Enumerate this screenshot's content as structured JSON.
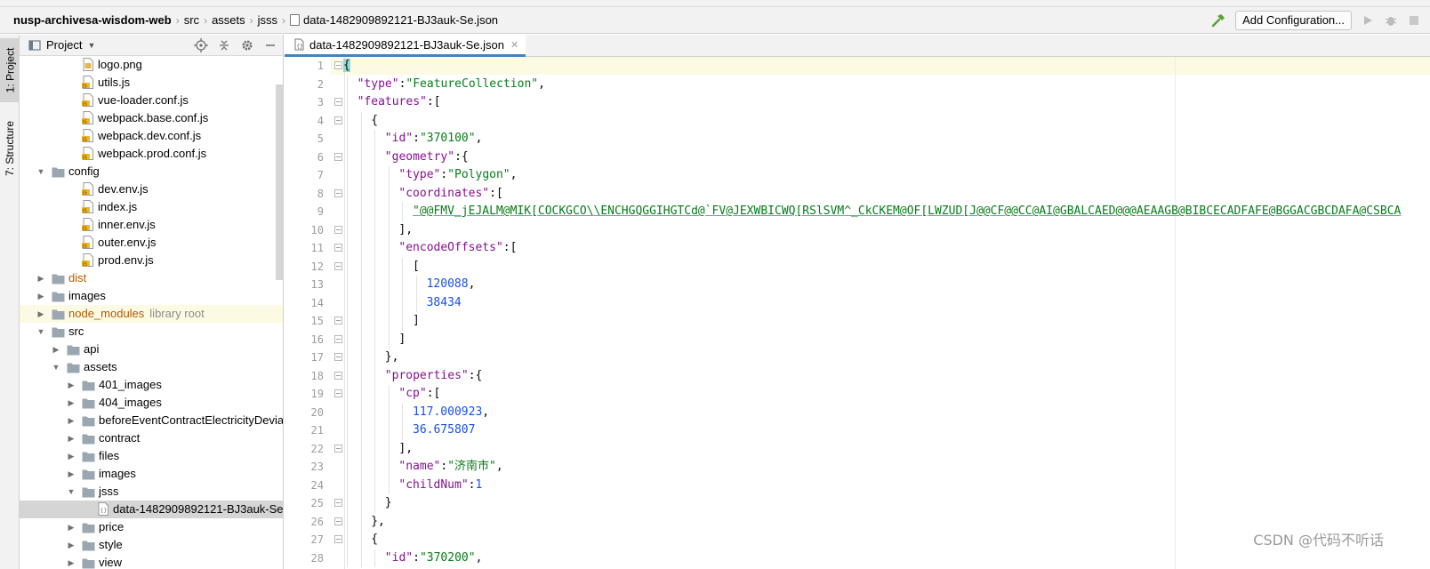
{
  "navbar": {
    "breadcrumbs": [
      "nusp-archivesa-wisdom-web",
      "src",
      "assets",
      "jsss",
      "data-1482909892121-BJ3auk-Se.json"
    ],
    "add_config_label": "Add Configuration..."
  },
  "toolstrip": {
    "project_tab": "1: Project",
    "structure_tab": "7: Structure"
  },
  "project_panel": {
    "title": "Project",
    "library_root_label": "library root",
    "tree": [
      {
        "label": "logo.png",
        "kind": "png",
        "depth": 3
      },
      {
        "label": "utils.js",
        "kind": "js",
        "depth": 3
      },
      {
        "label": "vue-loader.conf.js",
        "kind": "js",
        "depth": 3
      },
      {
        "label": "webpack.base.conf.js",
        "kind": "js",
        "depth": 3
      },
      {
        "label": "webpack.dev.conf.js",
        "kind": "js",
        "depth": 3
      },
      {
        "label": "webpack.prod.conf.js",
        "kind": "js",
        "depth": 3
      },
      {
        "label": "config",
        "kind": "folder",
        "depth": 1,
        "expanded": true
      },
      {
        "label": "dev.env.js",
        "kind": "js",
        "depth": 3
      },
      {
        "label": "index.js",
        "kind": "js",
        "depth": 3
      },
      {
        "label": "inner.env.js",
        "kind": "js",
        "depth": 3
      },
      {
        "label": "outer.env.js",
        "kind": "js",
        "depth": 3
      },
      {
        "label": "prod.env.js",
        "kind": "js",
        "depth": 3
      },
      {
        "label": "dist",
        "kind": "folder",
        "depth": 1,
        "expanded": false,
        "style": "excluded"
      },
      {
        "label": "images",
        "kind": "folder",
        "depth": 1,
        "expanded": false
      },
      {
        "label": "node_modules",
        "kind": "folder",
        "depth": 1,
        "expanded": false,
        "style": "library"
      },
      {
        "label": "src",
        "kind": "folder",
        "depth": 1,
        "expanded": true
      },
      {
        "label": "api",
        "kind": "folder",
        "depth": 2,
        "expanded": false
      },
      {
        "label": "assets",
        "kind": "folder",
        "depth": 2,
        "expanded": true
      },
      {
        "label": "401_images",
        "kind": "folder",
        "depth": 3,
        "expanded": false
      },
      {
        "label": "404_images",
        "kind": "folder",
        "depth": 3,
        "expanded": false
      },
      {
        "label": "beforeEventContractElectricityDevia",
        "kind": "folder",
        "depth": 3,
        "expanded": false
      },
      {
        "label": "contract",
        "kind": "folder",
        "depth": 3,
        "expanded": false
      },
      {
        "label": "files",
        "kind": "folder",
        "depth": 3,
        "expanded": false
      },
      {
        "label": "images",
        "kind": "folder",
        "depth": 3,
        "expanded": false
      },
      {
        "label": "jsss",
        "kind": "folder",
        "depth": 3,
        "expanded": true
      },
      {
        "label": "data-1482909892121-BJ3auk-Se",
        "kind": "json",
        "depth": 4,
        "selected": true
      },
      {
        "label": "price",
        "kind": "folder",
        "depth": 3,
        "expanded": false
      },
      {
        "label": "style",
        "kind": "folder",
        "depth": 3,
        "expanded": false
      },
      {
        "label": "view",
        "kind": "folder",
        "depth": 3,
        "expanded": false
      }
    ]
  },
  "editor": {
    "tab_label": "data-1482909892121-BJ3auk-Se.json",
    "lines": [
      {
        "n": "1",
        "indent": 0,
        "fold": true,
        "tokens": [
          {
            "t": "p",
            "v": "{"
          }
        ]
      },
      {
        "n": "2",
        "indent": 1,
        "fold": false,
        "tokens": [
          {
            "t": "k",
            "v": "\"type\""
          },
          {
            "t": "p",
            "v": ":"
          },
          {
            "t": "s",
            "v": "\"FeatureCollection\""
          },
          {
            "t": "p",
            "v": ","
          }
        ]
      },
      {
        "n": "3",
        "indent": 1,
        "fold": true,
        "tokens": [
          {
            "t": "k",
            "v": "\"features\""
          },
          {
            "t": "p",
            "v": ":["
          }
        ]
      },
      {
        "n": "4",
        "indent": 2,
        "fold": true,
        "tokens": [
          {
            "t": "p",
            "v": "{"
          }
        ]
      },
      {
        "n": "5",
        "indent": 3,
        "fold": false,
        "tokens": [
          {
            "t": "k",
            "v": "\"id\""
          },
          {
            "t": "p",
            "v": ":"
          },
          {
            "t": "s",
            "v": "\"370100\""
          },
          {
            "t": "p",
            "v": ","
          }
        ]
      },
      {
        "n": "6",
        "indent": 3,
        "fold": true,
        "tokens": [
          {
            "t": "k",
            "v": "\"geometry\""
          },
          {
            "t": "p",
            "v": ":{"
          }
        ]
      },
      {
        "n": "7",
        "indent": 4,
        "fold": false,
        "tokens": [
          {
            "t": "k",
            "v": "\"type\""
          },
          {
            "t": "p",
            "v": ":"
          },
          {
            "t": "s",
            "v": "\"Polygon\""
          },
          {
            "t": "p",
            "v": ","
          }
        ]
      },
      {
        "n": "8",
        "indent": 4,
        "fold": true,
        "tokens": [
          {
            "t": "k",
            "v": "\"coordinates\""
          },
          {
            "t": "p",
            "v": ":["
          }
        ]
      },
      {
        "n": "9",
        "indent": 5,
        "fold": false,
        "tokens": [
          {
            "t": "s",
            "v": "\"@@FMV_jEJALM@MIK[COCKGCO\\\\ENCHGQGGIHGTCd@`FV@JEXWBICWQ[RSlSVM^_CkCKEM@OF[LWZUD[J@@CF@@CC@AI@GBALCAED@@@AEAAGB@BIBCECADFAFE@BGGACGBCDAFA@CSBCA"
          }
        ]
      },
      {
        "n": "10",
        "indent": 4,
        "fold": true,
        "tokens": [
          {
            "t": "p",
            "v": "],"
          }
        ]
      },
      {
        "n": "11",
        "indent": 4,
        "fold": true,
        "tokens": [
          {
            "t": "k",
            "v": "\"encodeOffsets\""
          },
          {
            "t": "p",
            "v": ":["
          }
        ]
      },
      {
        "n": "12",
        "indent": 5,
        "fold": true,
        "tokens": [
          {
            "t": "p",
            "v": "["
          }
        ]
      },
      {
        "n": "13",
        "indent": 6,
        "fold": false,
        "tokens": [
          {
            "t": "n",
            "v": "120088"
          },
          {
            "t": "p",
            "v": ","
          }
        ]
      },
      {
        "n": "14",
        "indent": 6,
        "fold": false,
        "tokens": [
          {
            "t": "n",
            "v": "38434"
          }
        ]
      },
      {
        "n": "15",
        "indent": 5,
        "fold": true,
        "tokens": [
          {
            "t": "p",
            "v": "]"
          }
        ]
      },
      {
        "n": "16",
        "indent": 4,
        "fold": true,
        "tokens": [
          {
            "t": "p",
            "v": "]"
          }
        ]
      },
      {
        "n": "17",
        "indent": 3,
        "fold": true,
        "tokens": [
          {
            "t": "p",
            "v": "},"
          }
        ]
      },
      {
        "n": "18",
        "indent": 3,
        "fold": true,
        "tokens": [
          {
            "t": "k",
            "v": "\"properties\""
          },
          {
            "t": "p",
            "v": ":{"
          }
        ]
      },
      {
        "n": "19",
        "indent": 4,
        "fold": true,
        "tokens": [
          {
            "t": "k",
            "v": "\"cp\""
          },
          {
            "t": "p",
            "v": ":["
          }
        ]
      },
      {
        "n": "20",
        "indent": 5,
        "fold": false,
        "tokens": [
          {
            "t": "n",
            "v": "117.000923"
          },
          {
            "t": "p",
            "v": ","
          }
        ]
      },
      {
        "n": "21",
        "indent": 5,
        "fold": false,
        "tokens": [
          {
            "t": "n",
            "v": "36.675807"
          }
        ]
      },
      {
        "n": "22",
        "indent": 4,
        "fold": true,
        "tokens": [
          {
            "t": "p",
            "v": "],"
          }
        ]
      },
      {
        "n": "23",
        "indent": 4,
        "fold": false,
        "tokens": [
          {
            "t": "k",
            "v": "\"name\""
          },
          {
            "t": "p",
            "v": ":"
          },
          {
            "t": "s",
            "v": "\"济南市\""
          },
          {
            "t": "p",
            "v": ","
          }
        ]
      },
      {
        "n": "24",
        "indent": 4,
        "fold": false,
        "tokens": [
          {
            "t": "k",
            "v": "\"childNum\""
          },
          {
            "t": "p",
            "v": ":"
          },
          {
            "t": "n",
            "v": "1"
          }
        ]
      },
      {
        "n": "25",
        "indent": 3,
        "fold": true,
        "tokens": [
          {
            "t": "p",
            "v": "}"
          }
        ]
      },
      {
        "n": "26",
        "indent": 2,
        "fold": true,
        "tokens": [
          {
            "t": "p",
            "v": "},"
          }
        ]
      },
      {
        "n": "27",
        "indent": 2,
        "fold": true,
        "tokens": [
          {
            "t": "p",
            "v": "{"
          }
        ]
      },
      {
        "n": "28",
        "indent": 3,
        "fold": false,
        "tokens": [
          {
            "t": "k",
            "v": "\"id\""
          },
          {
            "t": "p",
            "v": ":"
          },
          {
            "t": "s",
            "v": "\"370200\""
          },
          {
            "t": "p",
            "v": ","
          }
        ]
      }
    ]
  },
  "watermark": "CSDN @代码不听话",
  "colors": {
    "accent": "#4083c9",
    "key": "#871094",
    "string": "#067d17",
    "number": "#1750eb",
    "excluded_folder": "#b45a00",
    "caret_row": "#fcfae3"
  }
}
